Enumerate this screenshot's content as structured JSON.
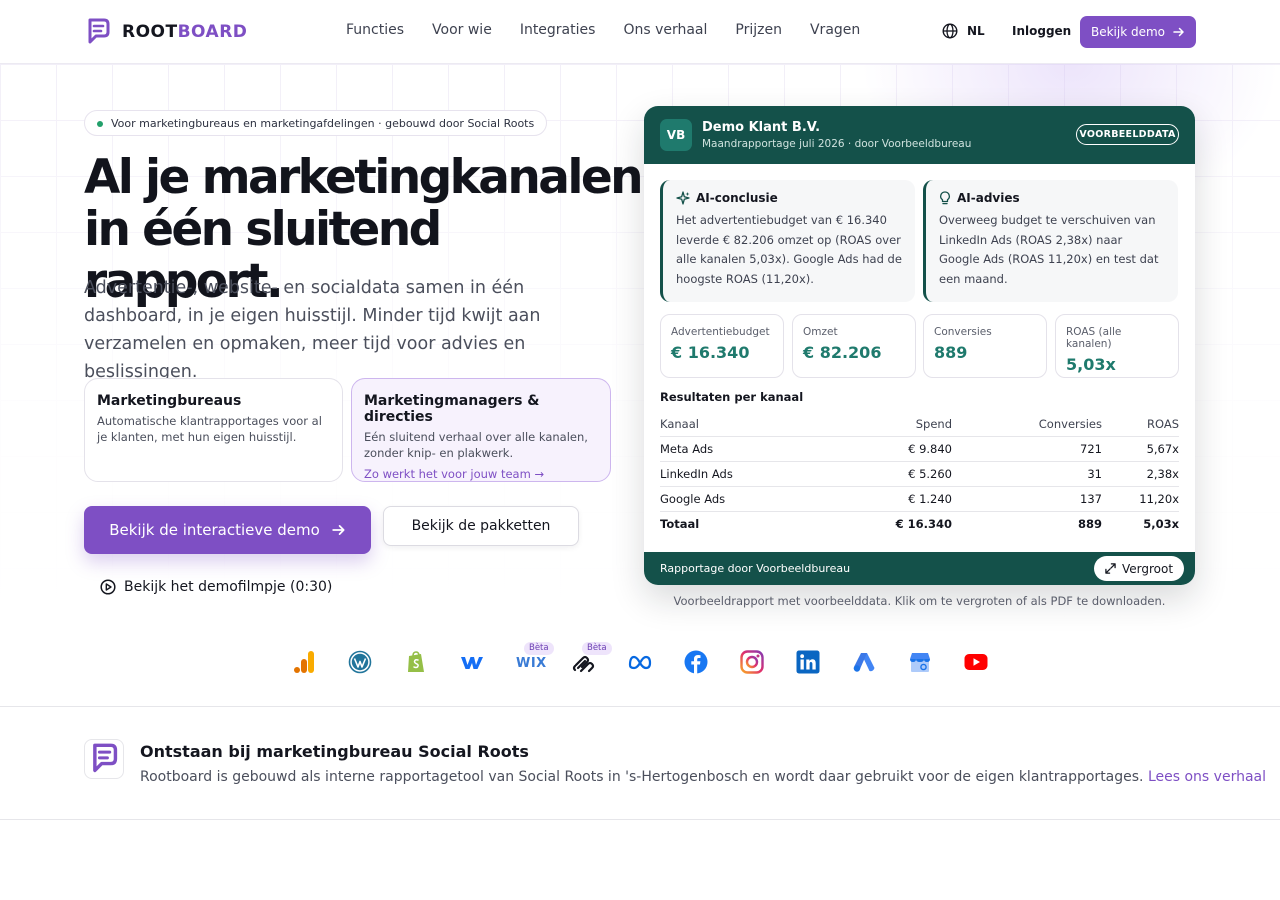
{
  "header": {
    "brand_root": "ROOT",
    "brand_board": "BOARD",
    "nav": [
      "Functies",
      "Voor wie",
      "Integraties",
      "Ons verhaal",
      "Prijzen",
      "Vragen"
    ],
    "language": "NL",
    "login": "Inloggen",
    "demo_button": "Bekijk demo"
  },
  "hero": {
    "pill": "Voor marketingbureaus en marketingafdelingen · gebouwd door Social Roots",
    "title_line1": "Al je marketingkanalen",
    "title_line2": "in één sluitend rapport.",
    "subtitle": "Advertentie-, website- en socialdata samen in één dashboard, in je eigen huisstijl. Minder tijd kwijt aan verzamelen en opmaken, meer tijd voor advies en beslissingen.",
    "cards": [
      {
        "title": "Marketingbureaus",
        "body": "Automatische klantrapportages voor al je klanten, met hun eigen huisstijl.",
        "link": ""
      },
      {
        "title": "Marketingmanagers & directies",
        "body": "Eén sluitend verhaal over alle kanalen, zonder knip- en plakwerk.",
        "link": "Zo werkt het voor jouw team →"
      }
    ],
    "primary_button": "Bekijk de interactieve demo",
    "secondary_button": "Bekijk de pakketten",
    "video_link": "Bekijk het demofilmpje (0:30)"
  },
  "report": {
    "avatar": "VB",
    "client": "Demo Klant B.V.",
    "meta": "Maandrapportage juli 2026 · door Voorbeeldbureau",
    "badge": "VOORBEELDDATA",
    "ai_conclusion_title": "AI-conclusie",
    "ai_conclusion_text": "Het advertentiebudget van € 16.340 leverde € 82.206 omzet op (ROAS over alle kanalen 5,03x). Google Ads had de hoogste ROAS (11,20x).",
    "ai_advice_title": "AI-advies",
    "ai_advice_text": "Overweeg budget te verschuiven van LinkedIn Ads (ROAS 2,38x) naar Google Ads (ROAS 11,20x) en test dat een maand.",
    "kpis": [
      {
        "label": "Advertentiebudget",
        "value": "€ 16.340"
      },
      {
        "label": "Omzet",
        "value": "€ 82.206"
      },
      {
        "label": "Conversies",
        "value": "889"
      },
      {
        "label": "ROAS (alle kanalen)",
        "value": "5,03x"
      }
    ],
    "results_title": "Resultaten per kanaal",
    "table_headers": [
      "Kanaal",
      "Spend",
      "Conversies",
      "ROAS"
    ],
    "table_rows": [
      [
        "Meta Ads",
        "€ 9.840",
        "721",
        "5,67x"
      ],
      [
        "LinkedIn Ads",
        "€ 5.260",
        "31",
        "2,38x"
      ],
      [
        "Google Ads",
        "€ 1.240",
        "137",
        "11,20x"
      ]
    ],
    "table_total": [
      "Totaal",
      "€ 16.340",
      "889",
      "5,03x"
    ],
    "footer": "Rapportage door Voorbeeldbureau",
    "enlarge_button": "Vergroot",
    "caption": "Voorbeeldrapport met voorbeelddata. Klik om te vergroten of als PDF te downloaden."
  },
  "integrations": {
    "beta_label": "Bèta",
    "wix_text": "WIX",
    "icons": [
      "google-analytics-icon",
      "wordpress-icon",
      "shopify-icon",
      "webflow-icon",
      "wix-icon",
      "squarespace-icon",
      "meta-icon",
      "facebook-icon",
      "instagram-icon",
      "linkedin-icon",
      "google-ads-icon",
      "google-business-icon",
      "youtube-icon"
    ]
  },
  "origin": {
    "title": "Ontstaan bij marketingbureau Social Roots",
    "text": "Rootboard is gebouwd als interne rapportagetool van Social Roots in 's-Hertogenbosch en wordt daar gebruikt voor de eigen klantrapportages.",
    "link": "Lees ons verhaal"
  },
  "colors": {
    "brand_purple": "#7e4fc4",
    "report_green": "#14514a",
    "kpi_green": "#1f7a6d"
  }
}
